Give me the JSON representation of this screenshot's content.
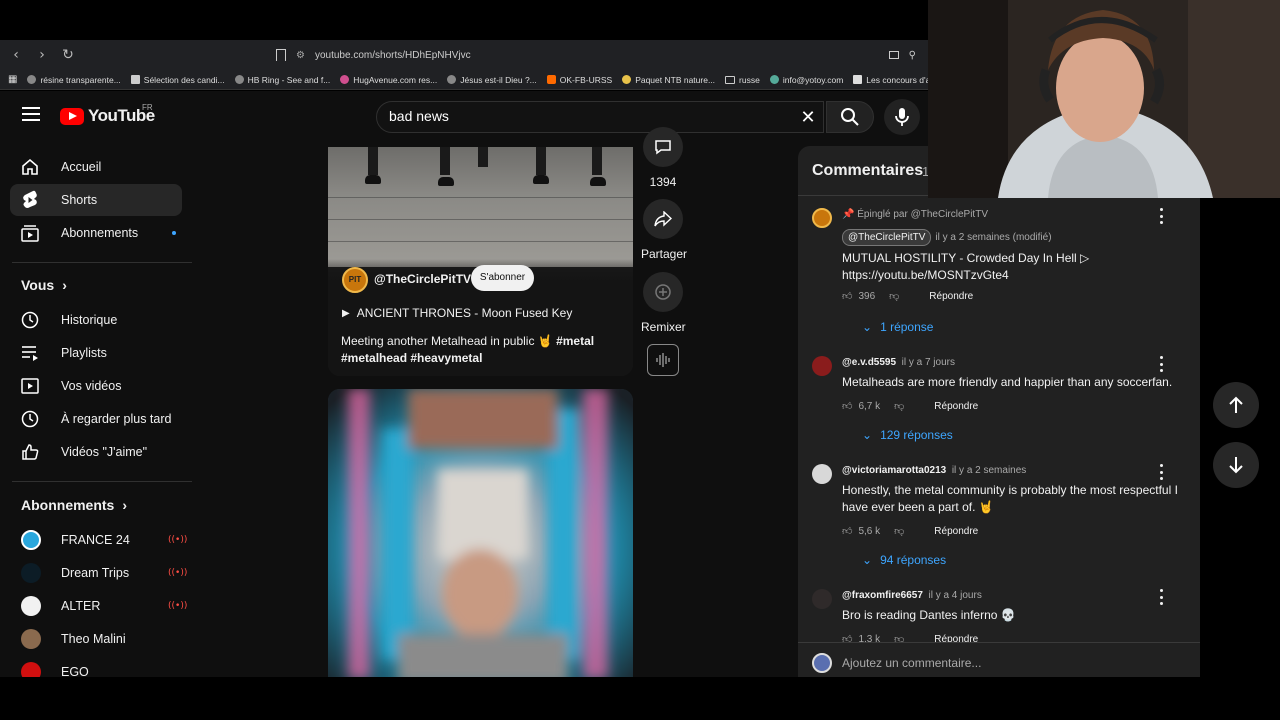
{
  "browser": {
    "url": "youtube.com/shorts/HDhEpNHVjvc",
    "bookmarks": [
      "résine transparente...",
      "Sélection des candi...",
      "HB Ring - See and f...",
      "HugAvenue.com res...",
      "Jésus est-il Dieu ?...",
      "OK-FB-URSS",
      "Paquet NTB nature...",
      "russe",
      "info@yotoy.com",
      "Les concours d'a"
    ]
  },
  "masthead": {
    "logo_text": "YouTube",
    "region": "FR",
    "search_value": "bad news"
  },
  "sidebar": {
    "main": [
      {
        "label": "Accueil"
      },
      {
        "label": "Shorts"
      },
      {
        "label": "Abonnements"
      }
    ],
    "you_heading": "Vous",
    "you_items": [
      {
        "label": "Historique"
      },
      {
        "label": "Playlists"
      },
      {
        "label": "Vos vidéos"
      },
      {
        "label": "À regarder plus tard"
      },
      {
        "label": "Vidéos \"J'aime\""
      }
    ],
    "subs_heading": "Abonnements",
    "subs": [
      {
        "label": "FRANCE 24",
        "live": true
      },
      {
        "label": "Dream Trips",
        "live": true
      },
      {
        "label": "ALTER",
        "live": true
      },
      {
        "label": "Theo Malini",
        "live": false
      },
      {
        "label": "EGO",
        "live": false
      }
    ]
  },
  "short": {
    "channel": "@TheCirclePitTV",
    "channel_badge": "PIT",
    "subscribe_label": "S'abonner",
    "music": "ANCIENT THRONES - Moon Fused Key",
    "description_text": "Meeting another Metalhead in public 🤘 ",
    "description_tags_1": "#metal",
    "description_tags_2": "#metalhead #heavymetal"
  },
  "actions": {
    "comment_count": "1394",
    "share_label": "Partager",
    "remix_label": "Remixer"
  },
  "comments": {
    "title": "Commentaires",
    "count": "1",
    "items": [
      {
        "pinned_by": "Épinglé par @TheCirclePitTV",
        "author": "@TheCirclePitTV",
        "time": "il y a 2 semaines (modifié)",
        "text_1": "MUTUAL HOSTILITY - Crowded Day In Hell ▷",
        "text_2": "https://youtu.be/MOSNTzvGte4",
        "likes": "396",
        "reply_label": "Répondre",
        "replies": "1 réponse"
      },
      {
        "author": "@e.v.d5595",
        "time": "il y a 7 jours",
        "text_1": "Metalheads are  more friendly and happier than any soccerfan.",
        "likes": "6,7 k",
        "reply_label": "Répondre",
        "replies": "129 réponses"
      },
      {
        "author": "@victoriamarotta0213",
        "time": "il y a 2 semaines",
        "text_1": "Honestly, the metal community is probably the most respectful I have ever been a part of. 🤘",
        "likes": "5,6 k",
        "reply_label": "Répondre",
        "replies": "94 réponses"
      },
      {
        "author": "@fraxomfire6657",
        "time": "il y a 4 jours",
        "text_1": "Bro is reading Dantes inferno 💀",
        "likes": "1,3 k",
        "reply_label": "Répondre"
      }
    ],
    "add_placeholder": "Ajoutez un commentaire..."
  },
  "colors": {
    "background": "#0f0f0f",
    "panel": "#212121",
    "accent_blue": "#3ea6ff",
    "live_red": "#ff4e45",
    "brand_red": "#ff0000"
  }
}
